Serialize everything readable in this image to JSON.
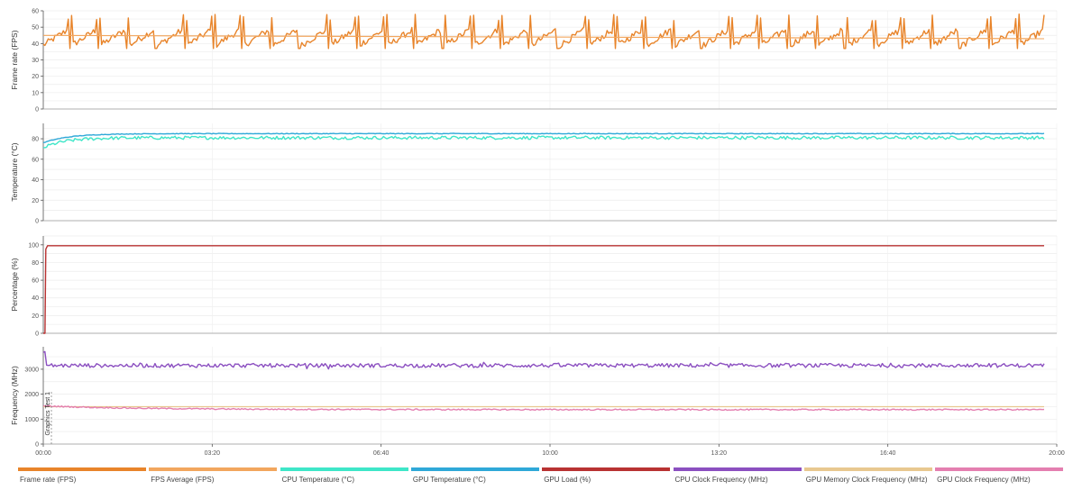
{
  "chart_data": {
    "type": "line",
    "x_axis": {
      "ticks": [
        "00:00",
        "03:20",
        "06:40",
        "10:00",
        "13:20",
        "16:40",
        "20:00"
      ],
      "tick_seconds": [
        0,
        200,
        400,
        600,
        800,
        1000,
        1200
      ],
      "range_seconds": [
        0,
        1200
      ],
      "data_end_seconds": 1185
    },
    "panels": [
      {
        "ylabel": "Frame rate (FPS)",
        "ylim": [
          0,
          60
        ],
        "yticks": [
          0,
          10,
          20,
          30,
          40,
          50,
          60
        ],
        "series": [
          {
            "name": "Frame rate (FPS)",
            "pattern": "sawtooth",
            "base": 39,
            "peak": 56,
            "period": 34,
            "noise": 2
          },
          {
            "name": "FPS Average (FPS)",
            "points": [
              [
                0,
                45
              ],
              [
                1185,
                43
              ]
            ]
          }
        ]
      },
      {
        "ylabel": "Temperature (°C)",
        "ylim": [
          0,
          95
        ],
        "yticks": [
          0,
          20,
          40,
          60,
          80
        ],
        "series": [
          {
            "name": "CPU Temperature (°C)",
            "pattern": "rise",
            "start": 71,
            "plateau": 81,
            "tau": 25,
            "noise": 1.6
          },
          {
            "name": "GPU Temperature (°C)",
            "pattern": "rise",
            "start": 76,
            "plateau": 85,
            "tau": 30,
            "noise": 0.3
          }
        ]
      },
      {
        "ylabel": "Percentage (%)",
        "ylim": [
          0,
          110
        ],
        "yticks": [
          0,
          20,
          40,
          60,
          80,
          100
        ],
        "series": [
          {
            "name": "GPU Load (%)",
            "points": [
              [
                0,
                0
              ],
              [
                2,
                0
              ],
              [
                3,
                95
              ],
              [
                5,
                99
              ],
              [
                1185,
                99
              ]
            ]
          }
        ]
      },
      {
        "ylabel": "Frequency (MHz)",
        "ylim": [
          0,
          3900
        ],
        "yticks": [
          0,
          1000,
          2000,
          3000
        ],
        "series": [
          {
            "name": "CPU Clock Frequency (MHz)",
            "pattern": "noisy",
            "start": 3700,
            "level": 3150,
            "noise": 80
          },
          {
            "name": "GPU Memory Clock Frequency (MHz)",
            "points": [
              [
                0,
                1500
              ],
              [
                1185,
                1500
              ]
            ]
          },
          {
            "name": "GPU Clock Frequency (MHz)",
            "pattern": "drift",
            "start": 1530,
            "level": 1380,
            "noise": 25
          }
        ],
        "annotation": "Graphics Test 1"
      }
    ],
    "legend": {
      "position": "bottom",
      "items": [
        {
          "label": "Frame rate (FPS)",
          "color": "#e8842a"
        },
        {
          "label": "FPS Average (FPS)",
          "color": "#f2a65e"
        },
        {
          "label": "CPU Temperature (°C)",
          "color": "#3ee6c8"
        },
        {
          "label": "GPU Temperature (°C)",
          "color": "#2fa8d8"
        },
        {
          "label": "GPU Load (%)",
          "color": "#b83232"
        },
        {
          "label": "CPU Clock Frequency (MHz)",
          "color": "#8b4fc0"
        },
        {
          "label": "GPU Memory Clock Frequency (MHz)",
          "color": "#e8c890"
        },
        {
          "label": "GPU Clock Frequency (MHz)",
          "color": "#e47fb0"
        }
      ]
    }
  }
}
